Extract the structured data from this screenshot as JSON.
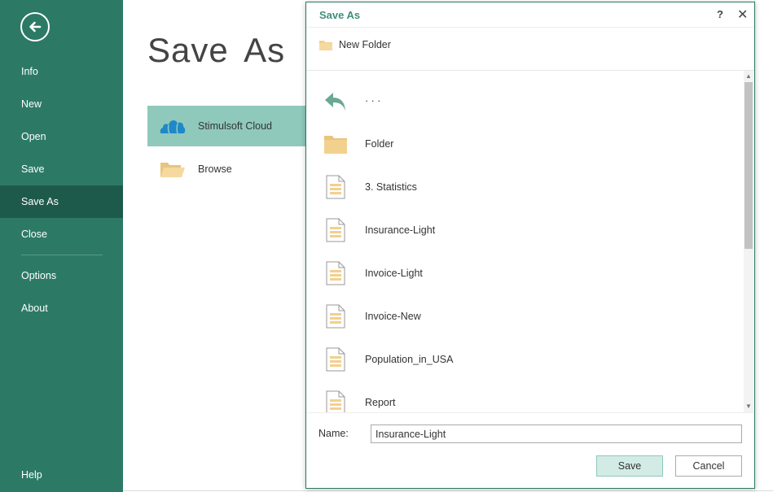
{
  "sidebar": {
    "back_icon": "arrow-left-circle-icon",
    "items": [
      {
        "label": "Info"
      },
      {
        "label": "New"
      },
      {
        "label": "Open"
      },
      {
        "label": "Save"
      },
      {
        "label": "Save As",
        "active": true
      },
      {
        "label": "Close"
      },
      {
        "label": "Options"
      },
      {
        "label": "About"
      },
      {
        "label": "Help"
      }
    ]
  },
  "main": {
    "title": "Save  As",
    "locations": [
      {
        "label": "Stimulsoft Cloud",
        "icon": "cloud-icon",
        "selected": true
      },
      {
        "label": "Browse",
        "icon": "folder-open-icon",
        "selected": false
      }
    ]
  },
  "dialog": {
    "title": "Save As",
    "help": "?",
    "close": "✕",
    "new_folder": "New Folder",
    "files": [
      {
        "name": "· · ·",
        "icon": "back-arrow-icon"
      },
      {
        "name": "Folder",
        "icon": "folder-icon"
      },
      {
        "name": "3. Statistics",
        "icon": "report-file-icon"
      },
      {
        "name": "Insurance-Light",
        "icon": "report-file-icon"
      },
      {
        "name": "Invoice-Light",
        "icon": "report-file-icon"
      },
      {
        "name": "Invoice-New",
        "icon": "report-file-icon"
      },
      {
        "name": "Population_in_USA",
        "icon": "report-file-icon"
      },
      {
        "name": "Report",
        "icon": "report-file-icon"
      }
    ],
    "name_label": "Name:",
    "name_value": "Insurance-Light",
    "save_label": "Save",
    "cancel_label": "Cancel"
  },
  "colors": {
    "sidebar_bg": "#2c7a66",
    "sidebar_active": "#1e5a4b",
    "selected_location": "#8fc9bc",
    "accent_title": "#3f8f7c",
    "folder": "#f2d08e"
  }
}
